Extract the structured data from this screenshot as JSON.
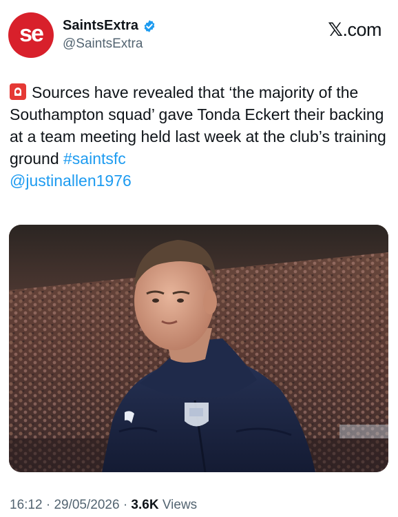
{
  "author": {
    "avatar_text": "se",
    "display_name": "SaintsExtra",
    "handle": "@SaintsExtra",
    "verified": true
  },
  "brand": {
    "label": ".com",
    "icon": "x-logo-icon"
  },
  "tweet": {
    "emoji": "rotating-light-icon",
    "body": "Sources have revealed that ‘the majority of the Southampton squad’ gave Tonda Eckert their backing at a team meeting held last week at the club’s training ground",
    "hashtag": "#saintsfc",
    "mention": "@justinallen1976"
  },
  "media": {
    "type": "photo",
    "jacket_badge": "SOUTHAMPTON FC"
  },
  "meta": {
    "time": "16:12",
    "separator": "·",
    "date": "29/05/2026",
    "views_count": "3.6K",
    "views_label": "Views"
  },
  "colors": {
    "link": "#1d9bf0",
    "avatar_bg": "#d8202b",
    "verified": "#1d9bf0",
    "muted": "#536471"
  }
}
